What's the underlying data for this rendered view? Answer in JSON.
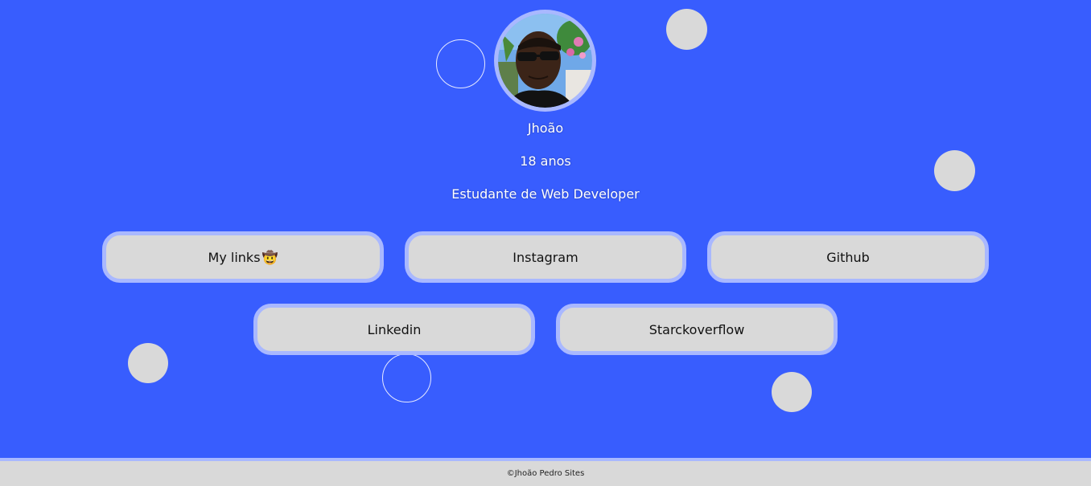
{
  "profile": {
    "name": "Jhoão",
    "age": "18 anos",
    "role": "Estudante de Web Developer"
  },
  "links": {
    "my_links": "My links",
    "my_links_emoji": "🤠",
    "instagram": "Instagram",
    "github": "Github",
    "linkedin": "Linkedin",
    "stackoverflow": "Starckoverflow"
  },
  "footer": {
    "text": "©Jhoão Pedro Sites"
  },
  "colors": {
    "background": "#385dfe",
    "button_fill": "#d9d9d9",
    "button_border": "#a9b8ff",
    "text": "#ffffff"
  }
}
